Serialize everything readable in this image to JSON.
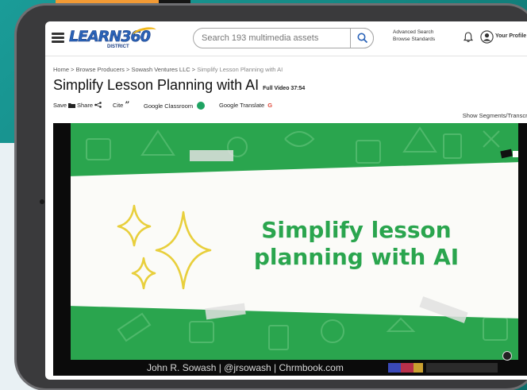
{
  "header": {
    "logo": {
      "name": "LEARN360",
      "subtitle": "DISTRICT"
    },
    "search": {
      "placeholder": "Search 193 multimedia assets"
    },
    "links": {
      "advanced_search": "Advanced Search",
      "browse_standards": "Browse Standards"
    },
    "profile_label": "Your Profile"
  },
  "breadcrumb": {
    "items": [
      "Home",
      "Browse Producers",
      "Sowash Ventures LLC"
    ],
    "separator": ">",
    "current": "Simplify Lesson Planning with AI"
  },
  "page": {
    "title": "Simplify Lesson Planning with AI",
    "video_badge": "Full Video 37:54"
  },
  "toolbar": {
    "save": "Save",
    "share": "Share",
    "cite": "Cite",
    "google_classroom": "Google Classroom",
    "google_translate": "Google Translate",
    "google_translate_icon": "G",
    "show_segments": "Show Segments/Transcript +"
  },
  "video": {
    "slide_line1": "Simplify lesson",
    "slide_line2": "planning with AI",
    "caption": "John R. Sowash | @jrsowash | Chrmbook.com"
  },
  "colors": {
    "brand_blue": "#2a63b8",
    "slide_green": "#2aa54e",
    "background_teal": "#1a9c98"
  }
}
